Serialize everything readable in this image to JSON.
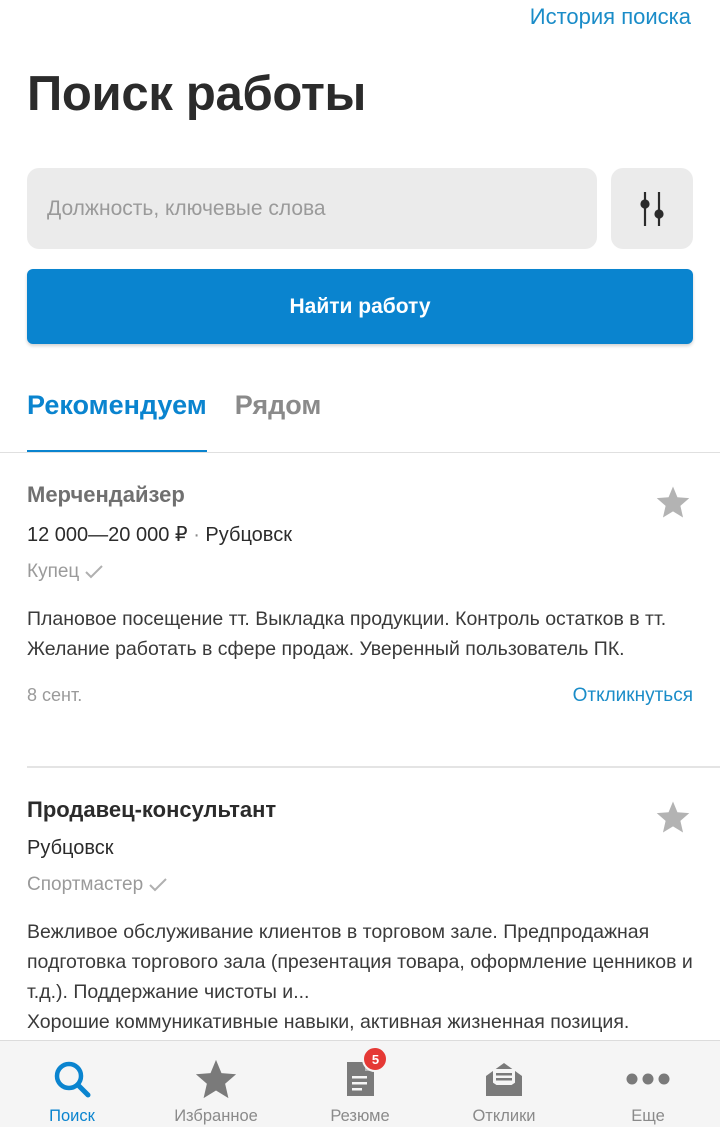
{
  "header": {
    "history_link": "История поиска",
    "title": "Поиск работы"
  },
  "search": {
    "placeholder": "Должность, ключевые слова",
    "value": "",
    "filter_icon": "sliders-icon",
    "find_button": "Найти работу"
  },
  "tabs": [
    {
      "label": "Рекомендуем",
      "active": true
    },
    {
      "label": "Рядом",
      "active": false
    }
  ],
  "vacancies": [
    {
      "title": "Мерчендайзер",
      "salary": "12 000—20 000 ₽",
      "separator": "·",
      "city": "Рубцовск",
      "company": "Купец",
      "description_lines": [
        "Плановое посещение тт. Выкладка продукции. Контроль остатков в тт.",
        "Желание работать в сфере продаж. Уверенный пользователь ПК."
      ],
      "date": "8 сент.",
      "respond_label": "Откликнуться"
    },
    {
      "title": "Продавец-консультант",
      "city": "Рубцовск",
      "company": "Спортмастер",
      "description_lines": [
        "Вежливое обслуживание клиентов в торговом зале. Предпродажная подготовка торгового зала (презентация товара, оформление ценников и т.д.). Поддержание чистоты и...",
        "Хорошие коммуникативные навыки, активная жизненная позиция."
      ]
    }
  ],
  "bottom_nav": [
    {
      "label": "Поиск",
      "icon": "search-icon",
      "active": true
    },
    {
      "label": "Избранное",
      "icon": "star-icon",
      "active": false
    },
    {
      "label": "Резюме",
      "icon": "document-icon",
      "active": false,
      "badge": "5"
    },
    {
      "label": "Отклики",
      "icon": "envelope-icon",
      "active": false
    },
    {
      "label": "Еще",
      "icon": "more-icon",
      "active": false
    }
  ],
  "colors": {
    "accent": "#0a84cf",
    "link": "#1a8cc8",
    "badge": "#e53935",
    "muted": "#9a9a9a"
  }
}
